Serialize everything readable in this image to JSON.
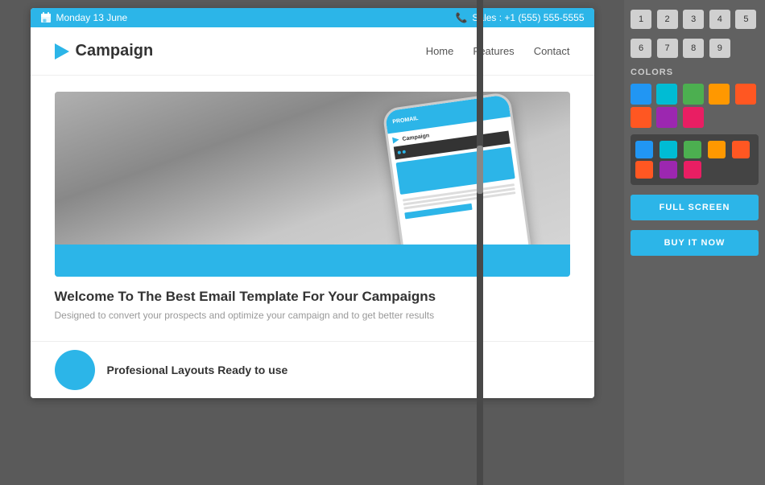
{
  "topbar": {
    "date": "Monday 13 June",
    "phone": "Sales : +1 (555) 555-5555"
  },
  "nav": {
    "logo_text": "Campaign",
    "links": [
      "Home",
      "Features",
      "Contact"
    ]
  },
  "hero": {
    "phone_header": "PROMAIL",
    "title": "Welcome To The Best Email Template For Your Campaigns",
    "subtitle": "Designed to convert your prospects and optimize your campaign and to get better results"
  },
  "section": {
    "title": "Profesional Layouts Ready to use"
  },
  "sidebar": {
    "numbers": {
      "row1": [
        "1",
        "2",
        "3",
        "4",
        "5"
      ],
      "row2": [
        "6",
        "7",
        "8",
        "9"
      ]
    },
    "colors_label": "COLORS",
    "light_swatches": [
      "#2196F3",
      "#00BCD4",
      "#4CAF50",
      "#FF9800",
      "#FF5722",
      "#FF5722",
      "#9C27B0",
      "#E91E63"
    ],
    "dark_bg": "#424242",
    "dark_swatches": [
      "#2196F3",
      "#00BCD4",
      "#4CAF50",
      "#FF9800",
      "#FF5722",
      "#FF5722",
      "#9C27B0",
      "#E91E63"
    ],
    "btn_fullscreen": "FULL SCREEN",
    "btn_buy": "BUY IT NOW"
  }
}
